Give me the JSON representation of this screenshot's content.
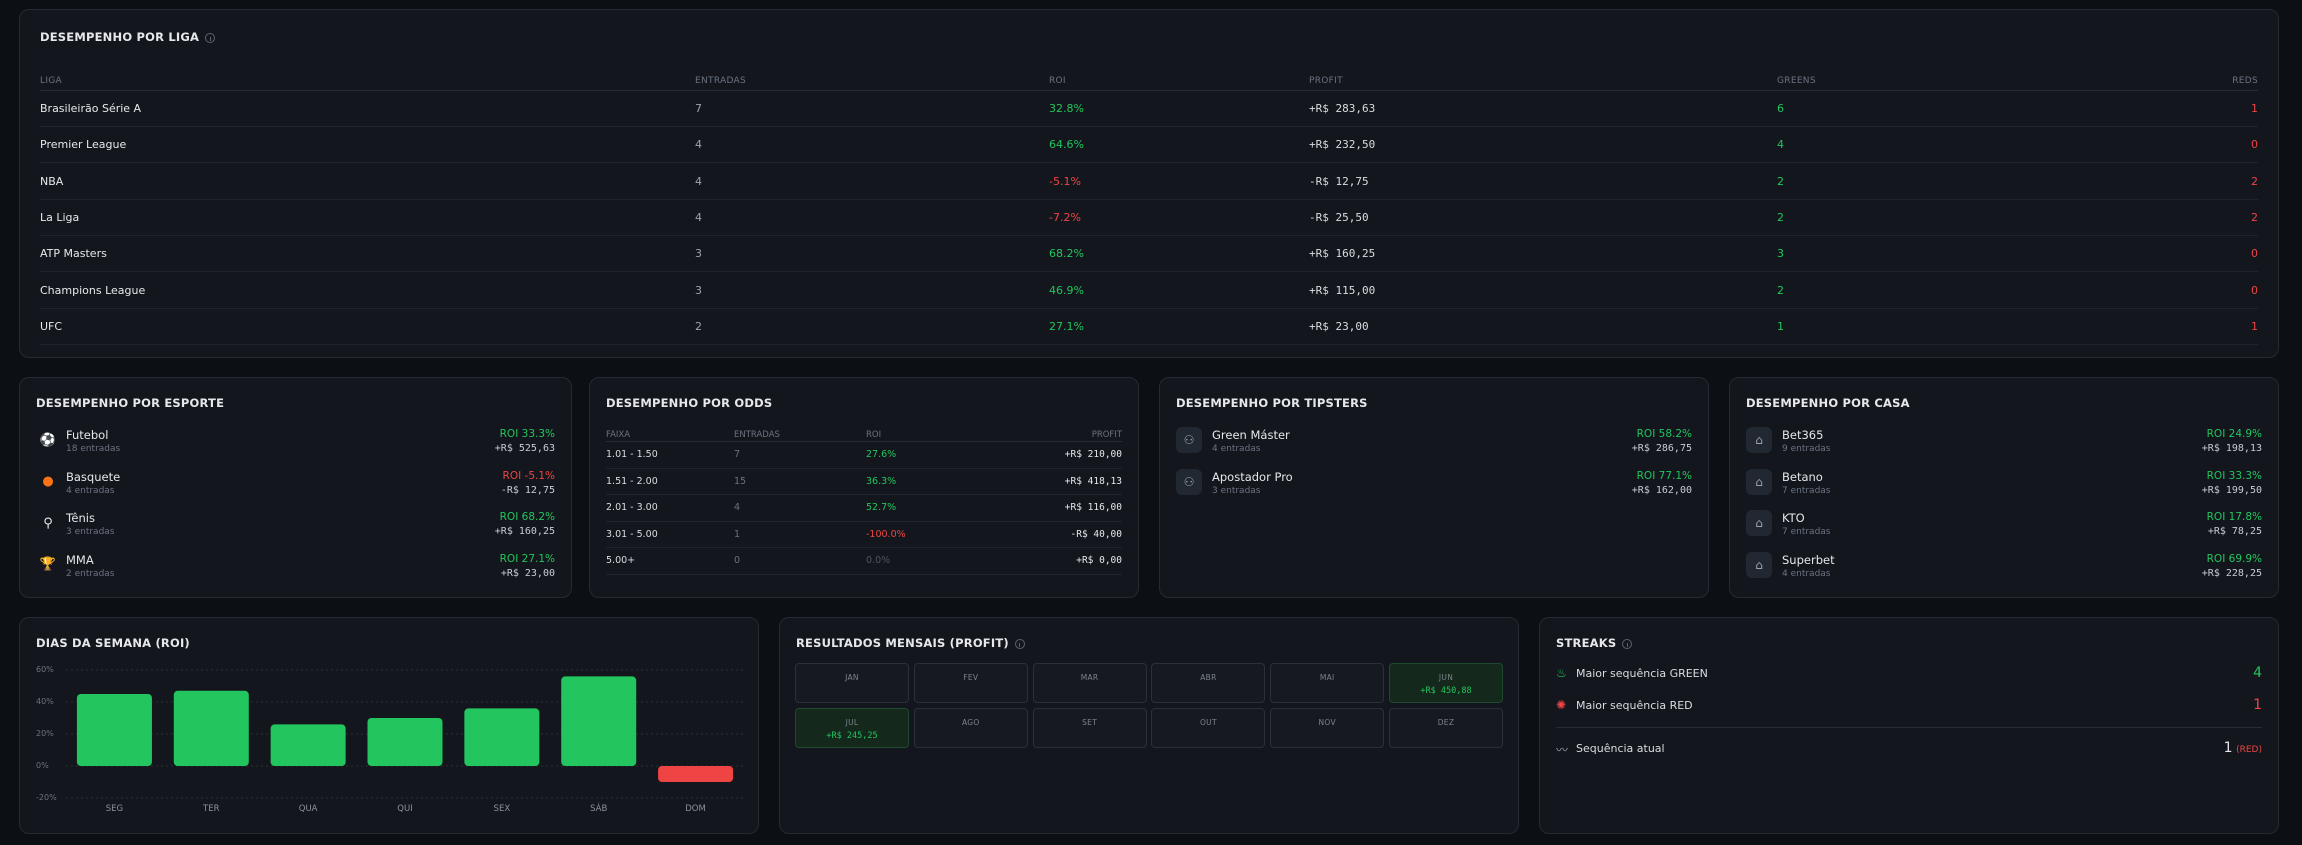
{
  "league": {
    "title": "DESEMPENHO POR LIGA",
    "headers": [
      "LIGA",
      "ENTRADAS",
      "ROI",
      "PROFIT",
      "GREENS",
      "REDS"
    ],
    "rows": [
      {
        "name": "Brasileirão Série A",
        "entries": "7",
        "roi": "32.8%",
        "profit": "+R$ 283,63",
        "greens": "6",
        "reds": "1"
      },
      {
        "name": "Premier League",
        "entries": "4",
        "roi": "64.6%",
        "profit": "+R$ 232,50",
        "greens": "4",
        "reds": "0"
      },
      {
        "name": "NBA",
        "entries": "4",
        "roi": "-5.1%",
        "profit": "-R$ 12,75",
        "greens": "2",
        "reds": "2"
      },
      {
        "name": "La Liga",
        "entries": "4",
        "roi": "-7.2%",
        "profit": "-R$ 25,50",
        "greens": "2",
        "reds": "2"
      },
      {
        "name": "ATP Masters",
        "entries": "3",
        "roi": "68.2%",
        "profit": "+R$ 160,25",
        "greens": "3",
        "reds": "0"
      },
      {
        "name": "Champions League",
        "entries": "3",
        "roi": "46.9%",
        "profit": "+R$ 115,00",
        "greens": "2",
        "reds": "0"
      },
      {
        "name": "UFC",
        "entries": "2",
        "roi": "27.1%",
        "profit": "+R$ 23,00",
        "greens": "1",
        "reds": "1"
      }
    ]
  },
  "sport": {
    "title": "DESEMPENHO POR ESPORTE",
    "items": [
      {
        "name": "Futebol",
        "sub": "18 entradas",
        "roi": "ROI 33.3%",
        "profit": "+R$ 525,63",
        "positive": true,
        "icon": "soccer-ball-icon"
      },
      {
        "name": "Basquete",
        "sub": "4 entradas",
        "roi": "ROI -5.1%",
        "profit": "-R$ 12,75",
        "positive": false,
        "icon": "basketball-icon"
      },
      {
        "name": "Tênis",
        "sub": "3 entradas",
        "roi": "ROI 68.2%",
        "profit": "+R$ 160,25",
        "positive": true,
        "icon": "tennis-icon"
      },
      {
        "name": "MMA",
        "sub": "2 entradas",
        "roi": "ROI 27.1%",
        "profit": "+R$ 23,00",
        "positive": true,
        "icon": "trophy-icon"
      }
    ]
  },
  "odds": {
    "title": "DESEMPENHO POR ODDS",
    "headers": [
      "FAIXA",
      "ENTRADAS",
      "ROI",
      "PROFIT"
    ],
    "rows": [
      {
        "range": "1.01 - 1.50",
        "entries": "7",
        "roi": "27.6%",
        "profit": "+R$ 210,00",
        "status": "pos"
      },
      {
        "range": "1.51 - 2.00",
        "entries": "15",
        "roi": "36.3%",
        "profit": "+R$ 418,13",
        "status": "pos"
      },
      {
        "range": "2.01 - 3.00",
        "entries": "4",
        "roi": "52.7%",
        "profit": "+R$ 116,00",
        "status": "pos"
      },
      {
        "range": "3.01 - 5.00",
        "entries": "1",
        "roi": "-100.0%",
        "profit": "-R$ 40,00",
        "status": "neg"
      },
      {
        "range": "5.00+",
        "entries": "0",
        "roi": "0.0%",
        "profit": "+R$ 0,00",
        "status": "zero"
      }
    ]
  },
  "tipsters": {
    "title": "DESEMPENHO POR TIPSTERS",
    "items": [
      {
        "name": "Green Máster",
        "sub": "4 entradas",
        "roi": "ROI 58.2%",
        "profit": "+R$ 286,75"
      },
      {
        "name": "Apostador Pro",
        "sub": "3 entradas",
        "roi": "ROI 77.1%",
        "profit": "+R$ 162,00"
      }
    ]
  },
  "houses": {
    "title": "DESEMPENHO POR CASA",
    "items": [
      {
        "name": "Bet365",
        "sub": "9 entradas",
        "roi": "ROI 24.9%",
        "profit": "+R$ 198,13"
      },
      {
        "name": "Betano",
        "sub": "7 entradas",
        "roi": "ROI 33.3%",
        "profit": "+R$ 199,50"
      },
      {
        "name": "KTO",
        "sub": "7 entradas",
        "roi": "ROI 17.8%",
        "profit": "+R$ 78,25"
      },
      {
        "name": "Superbet",
        "sub": "4 entradas",
        "roi": "ROI 69.9%",
        "profit": "+R$ 228,25"
      }
    ]
  },
  "weekday": {
    "title": "DIAS DA SEMANA (ROI)"
  },
  "chart_data": {
    "type": "bar",
    "title": "DIAS DA SEMANA (ROI)",
    "categories": [
      "SEG",
      "TER",
      "QUA",
      "QUI",
      "SEX",
      "SÁB",
      "DOM"
    ],
    "values": [
      45,
      47,
      26,
      30,
      36,
      56,
      -10
    ],
    "ylim": [
      -20,
      60
    ],
    "yticks": [
      "60%",
      "40%",
      "20%",
      "0%",
      "-20%"
    ],
    "grid": true,
    "colors": {
      "positive": "#22c55e",
      "negative": "#ef4444"
    }
  },
  "monthly": {
    "title": "RESULTADOS MENSAIS (PROFIT)",
    "months": [
      {
        "name": "JAN",
        "value": ""
      },
      {
        "name": "FEV",
        "value": ""
      },
      {
        "name": "MAR",
        "value": ""
      },
      {
        "name": "ABR",
        "value": ""
      },
      {
        "name": "MAI",
        "value": ""
      },
      {
        "name": "JUN",
        "value": "+R$ 450,88"
      },
      {
        "name": "JUL",
        "value": "+R$ 245,25"
      },
      {
        "name": "AGO",
        "value": ""
      },
      {
        "name": "SET",
        "value": ""
      },
      {
        "name": "OUT",
        "value": ""
      },
      {
        "name": "NOV",
        "value": ""
      },
      {
        "name": "DEZ",
        "value": ""
      }
    ]
  },
  "streaks": {
    "title": "STREAKS",
    "max_green_label": "Maior sequência GREEN",
    "max_green_value": "4",
    "max_red_label": "Maior sequência RED",
    "max_red_value": "1",
    "current_label": "Sequência atual",
    "current_value": "1",
    "current_tag": "(RED)"
  }
}
